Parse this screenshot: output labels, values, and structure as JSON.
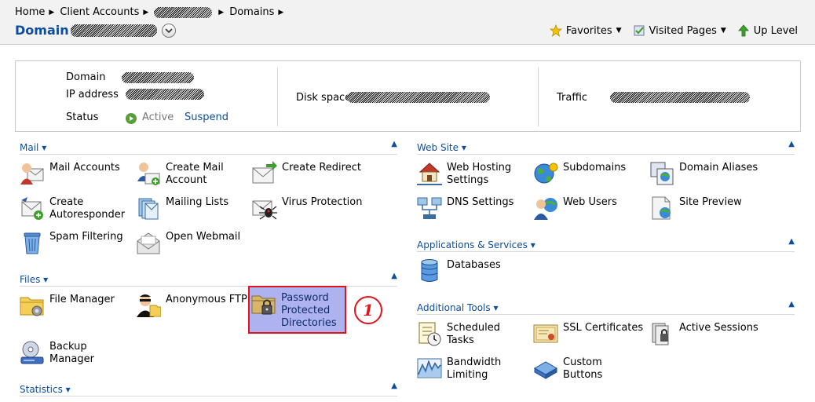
{
  "breadcrumb": {
    "home": "Home",
    "client_accounts": "Client Accounts",
    "domains": "Domains"
  },
  "page_title": "Domain",
  "top_actions": {
    "favorites": "Favorites",
    "visited_pages": "Visited Pages",
    "up_level": "Up Level"
  },
  "info": {
    "domain_label": "Domain",
    "ip_label": "IP address",
    "status_label": "Status",
    "status_value": "Active",
    "suspend": "Suspend",
    "disk_label": "Disk space",
    "traffic_label": "Traffic"
  },
  "sections": {
    "mail": "Mail",
    "files": "Files",
    "statistics": "Statistics",
    "web_site": "Web Site",
    "apps": "Applications & Services",
    "additional": "Additional Tools"
  },
  "tools": {
    "mail_accounts": "Mail Accounts",
    "create_mail_1": "Create Mail",
    "create_mail_2": "Account",
    "create_redirect": "Create Redirect",
    "create_auto_1": "Create",
    "create_auto_2": "Autoresponder",
    "mailing_lists": "Mailing Lists",
    "virus_protection": "Virus Protection",
    "spam_filtering": "Spam Filtering",
    "open_webmail": "Open Webmail",
    "file_manager": "File Manager",
    "anonymous_ftp": "Anonymous FTP",
    "ppd_1": "Password",
    "ppd_2": "Protected",
    "ppd_3": "Directories",
    "backup_1": "Backup",
    "backup_2": "Manager",
    "web_hosting_1": "Web Hosting",
    "web_hosting_2": "Settings",
    "subdomains": "Subdomains",
    "domain_aliases": "Domain Aliases",
    "dns_settings": "DNS Settings",
    "web_users": "Web Users",
    "site_preview": "Site Preview",
    "databases": "Databases",
    "scheduled_1": "Scheduled",
    "scheduled_2": "Tasks",
    "ssl_certificates": "SSL Certificates",
    "active_sessions": "Active Sessions",
    "bandwidth_1": "Bandwidth",
    "bandwidth_2": "Limiting",
    "custom_1": "Custom",
    "custom_2": "Buttons"
  },
  "callout_number": "1",
  "colors": {
    "link": "#0d4d9c",
    "highlight_bg": "#aeb2ee",
    "highlight_border": "#e0141c",
    "active_green": "#5a9d3c"
  }
}
